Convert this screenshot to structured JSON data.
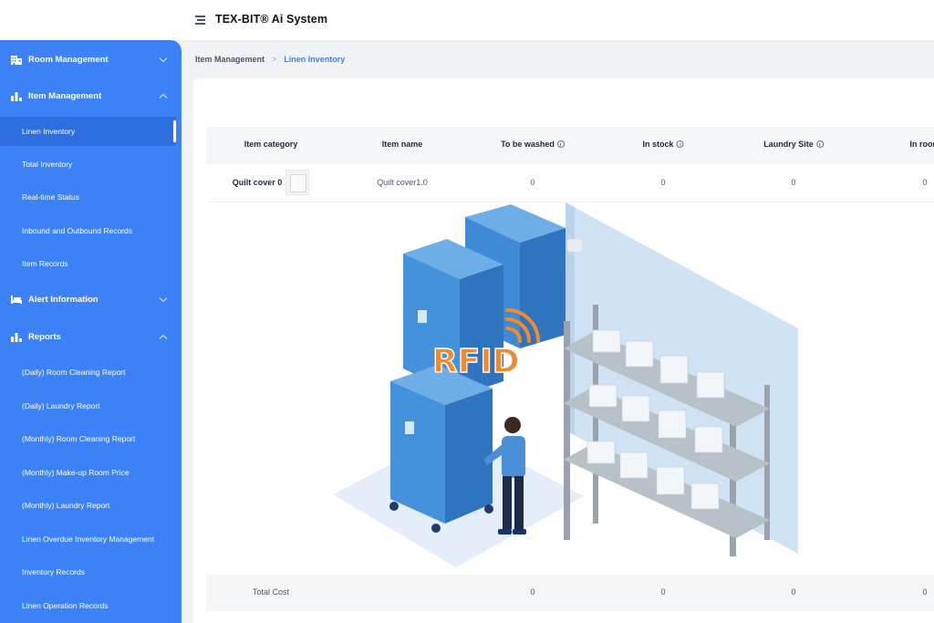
{
  "header": {
    "title": "TEX-BIT® Ai System"
  },
  "sidebar": {
    "groups": [
      {
        "label": "Room Management",
        "icon": "building-icon",
        "expanded": false
      },
      {
        "label": "Item Management",
        "icon": "bar-chart-icon",
        "expanded": true
      },
      {
        "label": "Alert Information",
        "icon": "bed-icon",
        "expanded": false
      },
      {
        "label": "Reports",
        "icon": "bar-chart-icon",
        "expanded": true
      }
    ],
    "item_management_items": [
      {
        "label": "Linen Inventory",
        "active": true
      },
      {
        "label": "Total Inventory"
      },
      {
        "label": "Real-time Status"
      },
      {
        "label": "Inbound and Outbound Records"
      },
      {
        "label": "Item Records"
      }
    ],
    "report_items": [
      {
        "label": "(Daily) Room Cleaning Report"
      },
      {
        "label": "(Daily) Laundry Report"
      },
      {
        "label": "(Monthly) Room Cleaning Report"
      },
      {
        "label": "(Monthly) Make-up Room Price"
      },
      {
        "label": "(Monthly) Laundry Report"
      },
      {
        "label": "Linen Overdue Inventory Management"
      },
      {
        "label": "Inventory Records"
      },
      {
        "label": "Linen Operation Records"
      }
    ]
  },
  "breadcrumb": {
    "parent": "Item Management",
    "separator": ">",
    "current": "Linen Inventory"
  },
  "table": {
    "columns": [
      "Item category",
      "Item name",
      "To be washed",
      "In stock",
      "Laundry Site",
      "In room"
    ],
    "rows": [
      {
        "category": "Quilt cover 0",
        "name": "Quilt cover1.0",
        "to_be_washed": "0",
        "in_stock": "0",
        "laundry_site": "0",
        "in_room": "0"
      }
    ],
    "footer": {
      "label": "Total Cost",
      "to_be_washed": "0",
      "in_stock": "0",
      "laundry_site": "0",
      "in_room": "0"
    }
  },
  "illustration": {
    "label": "RFID"
  },
  "colors": {
    "sidebar": "#3c82f6",
    "active_item": "#2e6fe0",
    "accent": "#3c82f6",
    "rfid_orange": "#f08a2c"
  }
}
